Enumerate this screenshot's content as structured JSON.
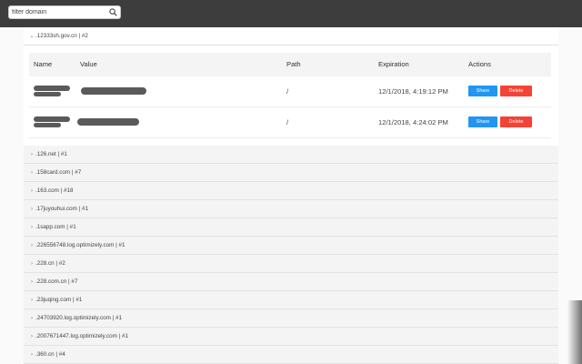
{
  "search": {
    "placeholder": "filter domain",
    "icon": "search-icon"
  },
  "expanded_domain": {
    "label": ".12333sh.gov.cn | #2"
  },
  "table": {
    "headers": [
      "Name",
      "Value",
      "Path",
      "Expiration",
      "Actions"
    ],
    "rows": [
      {
        "name": "",
        "value": "",
        "path": "/",
        "expiration": "12/1/2018, 4:19:12 PM"
      },
      {
        "name": "",
        "value": "",
        "path": "/",
        "expiration": "12/1/2018, 4:24:02 PM"
      }
    ],
    "share_label": "Share",
    "delete_label": "Delete"
  },
  "domains": [
    ".126.net | #1",
    ".158card.com | #7",
    ".163.com | #18",
    ".17juyouhui.com | #1",
    ".1sapp.com | #1",
    ".226556748.log.optimizely.com | #1",
    ".228.cn | #2",
    ".228.com.cn | #7",
    ".23juqing.com | #1",
    ".24703920.log.optimizely.com | #1",
    ".2007671447.log.optimizely.com | #1",
    ".360.cn | #4"
  ],
  "colors": {
    "topbar": "#3d3d3d",
    "share": "#2196f3",
    "delete": "#f44336"
  }
}
